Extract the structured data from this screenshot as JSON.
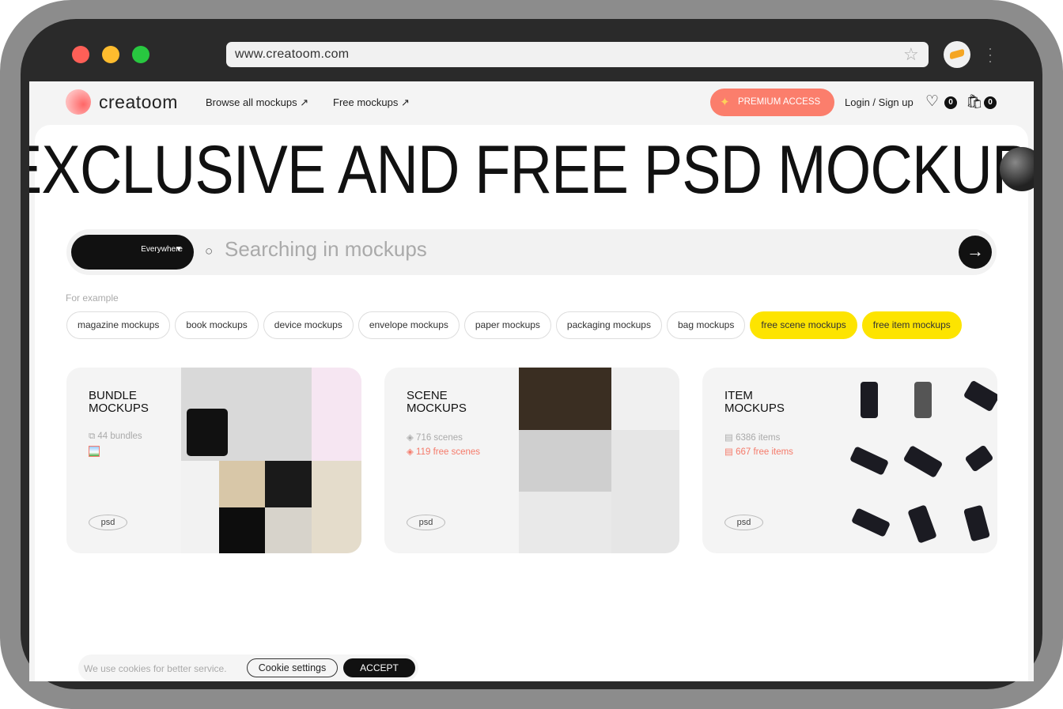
{
  "browser": {
    "url": "www.creatoom.com",
    "colors": {
      "close": "#fe5f57",
      "minimize": "#febc2e",
      "maximize": "#28c840"
    }
  },
  "nav": {
    "logo": "creatoom",
    "links": [
      "Browse all mockups ↗",
      "Free mockups ↗"
    ],
    "premium": "PREMIUM ACCESS",
    "login": "Login / Sign up",
    "wishlist_count": "0",
    "cart_count": "0"
  },
  "hero": {
    "title": "EXCLUSIVE AND FREE PSD MOCKUPS"
  },
  "search": {
    "scope": "Everywhere",
    "placeholder": "Searching in mockups"
  },
  "examples": {
    "label": "For example",
    "chips": [
      "magazine mockups",
      "book mockups",
      "device mockups",
      "envelope mockups",
      "paper mockups",
      "packaging mockups",
      "bag mockups",
      "free scene mockups",
      "free item mockups"
    ]
  },
  "cards": [
    {
      "title1": "BUNDLE",
      "title2": "MOCKUPS",
      "meta1": "44 bundles",
      "tag": "psd"
    },
    {
      "title1": "SCENE",
      "title2": "MOCKUPS",
      "meta1": "716 scenes",
      "meta2": "119 free scenes",
      "tag": "psd"
    },
    {
      "title1": "ITEM",
      "title2": "MOCKUPS",
      "meta1": "6386 items",
      "meta2": "667 free items",
      "tag": "psd"
    }
  ],
  "cookie": {
    "text": "We use cookies for better service.",
    "settings": "Cookie settings",
    "accept": "ACCEPT"
  }
}
